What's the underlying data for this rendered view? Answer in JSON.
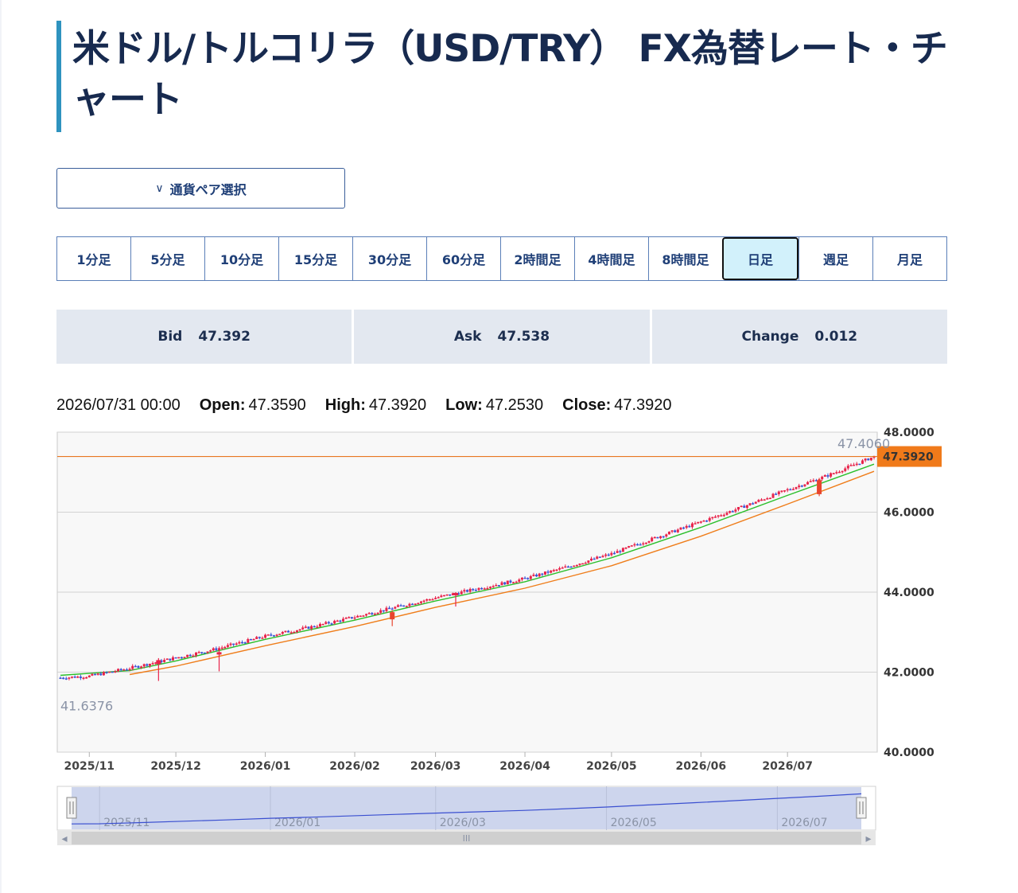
{
  "page": {
    "title": "米ドル/トルコリラ（USD/TRY） FX為替レート・チャート",
    "pair_select_label": "通貨ペア選択",
    "timeframes": [
      {
        "label": "1分足",
        "active": false
      },
      {
        "label": "5分足",
        "active": false
      },
      {
        "label": "10分足",
        "active": false
      },
      {
        "label": "15分足",
        "active": false
      },
      {
        "label": "30分足",
        "active": false
      },
      {
        "label": "60分足",
        "active": false
      },
      {
        "label": "2時間足",
        "active": false
      },
      {
        "label": "4時間足",
        "active": false
      },
      {
        "label": "8時間足",
        "active": false
      },
      {
        "label": "日足",
        "active": true
      },
      {
        "label": "週足",
        "active": false
      },
      {
        "label": "月足",
        "active": false
      }
    ],
    "quote": {
      "bid_label": "Bid",
      "bid": "47.392",
      "ask_label": "Ask",
      "ask": "47.538",
      "change_label": "Change",
      "change": "0.012"
    },
    "ohlc": {
      "datetime": "2026/07/31 00:00",
      "open_label": "Open:",
      "open": "47.3590",
      "high_label": "High:",
      "high": "47.3920",
      "low_label": "Low:",
      "low": "47.2530",
      "close_label": "Close:",
      "close": "47.3920"
    }
  },
  "colors": {
    "up_candle": "#e8234a",
    "down_candle": "#3b55d6",
    "bearish_large": "#e8452e",
    "ma_short": "#2bbf2b",
    "ma_long": "#ef7d1a",
    "price_line": "#e87722",
    "accent": "#2f93bf"
  },
  "chart_data": {
    "type": "candlestick",
    "x_tick_labels": [
      "2025/11",
      "2025/12",
      "2026/01",
      "2026/02",
      "2026/03",
      "2026/04",
      "2026/05",
      "2026/06",
      "2026/07"
    ],
    "y_tick_labels": [
      "40.0000",
      "42.0000",
      "44.0000",
      "46.0000",
      "48.0000"
    ],
    "ylim": [
      40,
      48
    ],
    "x_range": [
      "2025-10-22",
      "2026-07-31"
    ],
    "series": [
      {
        "points": [
          [
            "2025-10-22",
            41.86
          ],
          [
            "2025-11-01",
            41.9
          ],
          [
            "2025-11-15",
            42.1
          ],
          [
            "2025-12-01",
            42.36
          ],
          [
            "2025-12-15",
            42.58
          ],
          [
            "2026-01-01",
            42.9
          ],
          [
            "2026-01-15",
            43.1
          ],
          [
            "2026-02-01",
            43.38
          ],
          [
            "2026-02-15",
            43.62
          ],
          [
            "2026-03-01",
            43.86
          ],
          [
            "2026-03-15",
            44.08
          ],
          [
            "2026-04-01",
            44.34
          ],
          [
            "2026-04-15",
            44.62
          ],
          [
            "2026-05-01",
            44.96
          ],
          [
            "2026-05-15",
            45.33
          ],
          [
            "2026-06-01",
            45.76
          ],
          [
            "2026-06-15",
            46.12
          ],
          [
            "2026-07-01",
            46.56
          ],
          [
            "2026-07-15",
            46.92
          ],
          [
            "2026-07-31",
            47.39
          ]
        ]
      },
      {
        "points": [
          [
            "2025-10-22",
            41.92
          ],
          [
            "2025-11-15",
            42.04
          ],
          [
            "2025-12-01",
            42.28
          ],
          [
            "2026-01-01",
            42.82
          ],
          [
            "2026-02-01",
            43.3
          ],
          [
            "2026-03-01",
            43.78
          ],
          [
            "2026-04-01",
            44.26
          ],
          [
            "2026-05-01",
            44.86
          ],
          [
            "2026-06-01",
            45.62
          ],
          [
            "2026-07-01",
            46.42
          ],
          [
            "2026-07-31",
            47.2
          ]
        ]
      },
      {
        "points": [
          [
            "2025-11-15",
            41.94
          ],
          [
            "2025-12-01",
            42.15
          ],
          [
            "2026-01-01",
            42.66
          ],
          [
            "2026-02-01",
            43.14
          ],
          [
            "2026-03-01",
            43.62
          ],
          [
            "2026-04-01",
            44.1
          ],
          [
            "2026-05-01",
            44.66
          ],
          [
            "2026-06-01",
            45.4
          ],
          [
            "2026-07-01",
            46.2
          ],
          [
            "2026-07-31",
            47.02
          ]
        ]
      }
    ],
    "notable_candles": [
      {
        "date": "2025-11-25",
        "open": 42.2,
        "close": 42.3,
        "high": 42.35,
        "low": 41.78
      },
      {
        "date": "2025-12-16",
        "open": 42.45,
        "close": 42.5,
        "high": 42.52,
        "low": 42.02
      },
      {
        "date": "2026-02-14",
        "open": 43.5,
        "close": 43.32,
        "high": 43.55,
        "low": 43.15
      },
      {
        "date": "2026-03-08",
        "open": 43.95,
        "close": 43.98,
        "high": 44.0,
        "low": 43.64
      },
      {
        "date": "2026-07-12",
        "open": 46.8,
        "close": 46.45,
        "high": 46.85,
        "low": 46.4
      }
    ],
    "current_price_label": "47.3920",
    "max_label": "47.4060",
    "min_label": "41.6376",
    "navigator": {
      "x_tick_labels": [
        "2025/11",
        "2026/01",
        "2026/03",
        "2026/05",
        "2026/07"
      ],
      "scroll_grip": "III"
    }
  }
}
